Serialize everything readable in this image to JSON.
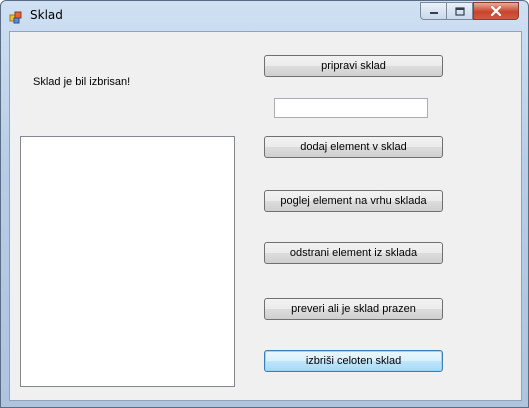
{
  "window": {
    "title": "Sklad"
  },
  "status_text": "Sklad je bil izbrisan!",
  "input": {
    "value": "",
    "placeholder": ""
  },
  "listbox": {
    "items": []
  },
  "buttons": {
    "prepare": "pripravi sklad",
    "add": "dodaj element v sklad",
    "peek": "poglej element na vrhu sklada",
    "remove": "odstrani element iz sklada",
    "check_empty": "preveri ali je sklad prazen",
    "clear": "izbriši celoten sklad"
  },
  "icons": {
    "app": "app-icon",
    "minimize": "minimize-icon",
    "maximize": "maximize-icon",
    "close": "close-icon"
  },
  "colors": {
    "titlebar": "#c4d6ec",
    "client_bg": "#f0f0f0",
    "close_button": "#c7452d",
    "focus_border": "#3c7fb1"
  }
}
